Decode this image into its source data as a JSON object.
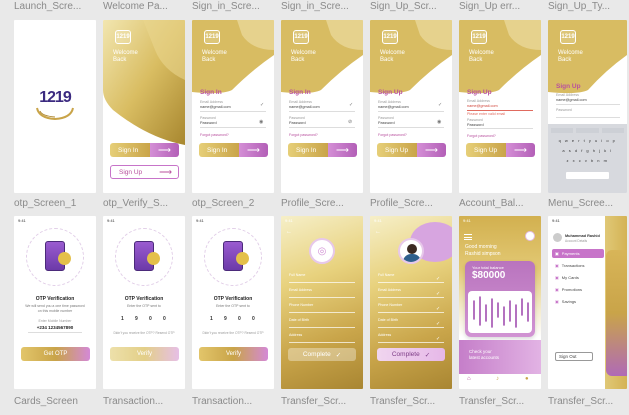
{
  "colors": {
    "gold": "#c9a449",
    "purple": "#c774c9",
    "bg": "#e9e9e9",
    "label": "#8a8a8a"
  },
  "row1_labels": [
    "Launch_Scre...",
    "Welcome Pa...",
    "Sign_in_Scre...",
    "Sign_in_Scre...",
    "Sign_Up_Scr...",
    "Sign_Up err...",
    "Sign_Up_Ty..."
  ],
  "row2_labels": [
    "otp_Screen_1",
    "otp_Verify_S...",
    "otp_Screen_2",
    "Profile_Scre...",
    "Profile_Scre...",
    "Account_Bal...",
    "Menu_Scree..."
  ],
  "row3_labels": [
    "Cards_Screen",
    "Transaction...",
    "Transaction...",
    "Transfer_Scr...",
    "Transfer_Scr...",
    "Transfer_Scr...",
    "Transfer_Scr..."
  ],
  "logo": "1219",
  "welcome": {
    "title": "Welcome",
    "subtitle": "Back",
    "sign_in": "Sign In",
    "sign_up": "Sign Up",
    "arrow": "⟶"
  },
  "signin": {
    "heading": "Sign In",
    "email_label": "Email Address",
    "email_value": "name@gmail.com",
    "password_label": "Password",
    "password_value": "Password",
    "forgot": "Forgot password?",
    "button": "Sign In"
  },
  "signup": {
    "heading": "Sign Up",
    "email_label": "Email Address",
    "email_value": "name@gmail.com",
    "password_label": "Password",
    "password_value": "Password",
    "forgot": "Forgot password?",
    "error": "Please enter valid email",
    "button": "Sign Up"
  },
  "otp": {
    "heading": "OTP Verification",
    "line1": "We will send you a one time password",
    "line2": "on this mobile number",
    "phone_label": "Enter Mobile Number",
    "phone": "+234 1234567890",
    "get_button": "Get OTP",
    "verify_button": "Verify",
    "sent_text": "Enter the OTP sent to",
    "digits": [
      "1",
      "9",
      "0",
      "0"
    ],
    "resend": "Didn't you receive the OTP? Resend OTP"
  },
  "profile": {
    "complete": "Complete",
    "check": "✓",
    "fields": [
      "Full Name",
      "Email Address",
      "Phone Number",
      "Date of Birth",
      "Address"
    ]
  },
  "balance": {
    "greeting": "Good morning",
    "name": "Rashid simpson",
    "label": "Your total balance",
    "amount": "$80000",
    "check_text": "Check your",
    "check_text2": "latest accounts"
  },
  "menu": {
    "name": "Muhammad Rashid",
    "sub": "Account Details",
    "items": [
      "Payments",
      "Transactions",
      "My Cards",
      "Promotions",
      "Savings"
    ],
    "sign_out": "Sign Out",
    "time": "9:41"
  },
  "keyboard_rows": [
    "q w e r t y u i o p",
    "a s d f g h j k l",
    "z x c v b n m"
  ],
  "status_time": "9:41"
}
